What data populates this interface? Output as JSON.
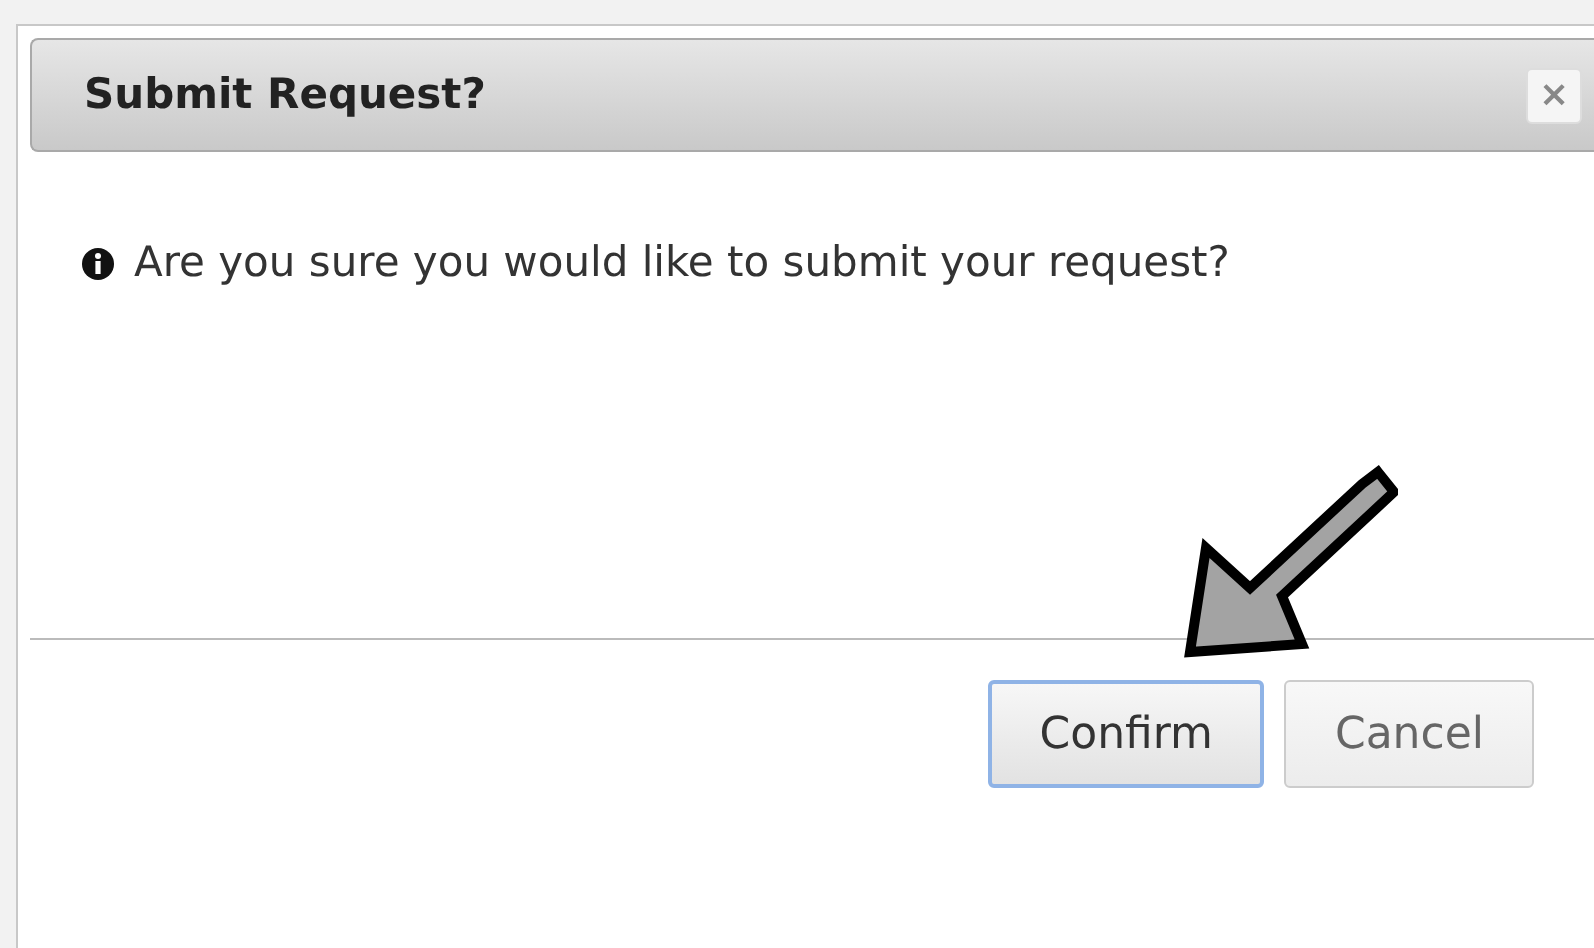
{
  "dialog": {
    "title": "Submit Request?",
    "close_label": "×",
    "message": "Are you sure you would like to submit your request?",
    "buttons": [
      {
        "label": "Confirm",
        "focused": true
      },
      {
        "label": "Cancel",
        "focused": false
      }
    ]
  }
}
